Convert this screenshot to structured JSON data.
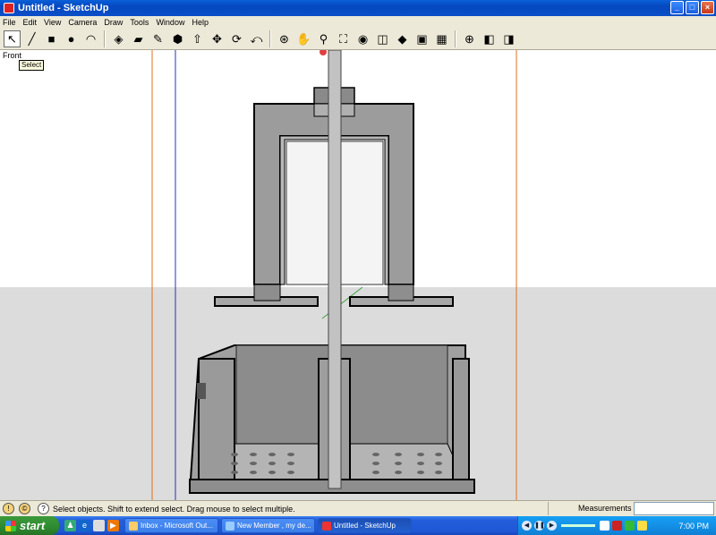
{
  "window": {
    "title": "Untitled - SketchUp",
    "buttons": {
      "minimize": "_",
      "maximize": "□",
      "close": "×"
    }
  },
  "menu": [
    "File",
    "Edit",
    "View",
    "Camera",
    "Draw",
    "Tools",
    "Window",
    "Help"
  ],
  "toolbar": {
    "tools": [
      {
        "name": "select",
        "glyph": "↖",
        "active": true
      },
      {
        "name": "line",
        "glyph": "╱"
      },
      {
        "name": "rectangle",
        "glyph": "■"
      },
      {
        "name": "circle",
        "glyph": "●"
      },
      {
        "name": "arc",
        "glyph": "◠"
      },
      {
        "name": "make-component",
        "glyph": "◈"
      },
      {
        "name": "eraser",
        "glyph": "▰"
      },
      {
        "name": "tape-measure",
        "glyph": "✎"
      },
      {
        "name": "paint-bucket",
        "glyph": "⬢"
      },
      {
        "name": "push-pull",
        "glyph": "⇧"
      },
      {
        "name": "move",
        "glyph": "✥"
      },
      {
        "name": "rotate",
        "glyph": "⟳"
      },
      {
        "name": "offset",
        "glyph": "⤺"
      },
      {
        "name": "orbit",
        "glyph": "⊛"
      },
      {
        "name": "pan",
        "glyph": "✋"
      },
      {
        "name": "zoom",
        "glyph": "⚲"
      },
      {
        "name": "zoom-extents",
        "glyph": "⛶"
      },
      {
        "name": "get-models",
        "glyph": "◉"
      },
      {
        "name": "share-model",
        "glyph": "◫"
      },
      {
        "name": "share-component",
        "glyph": "◆"
      },
      {
        "name": "get-photo-texture",
        "glyph": "▣"
      },
      {
        "name": "components",
        "glyph": "▦"
      },
      {
        "name": "position-camera",
        "glyph": "⊕"
      },
      {
        "name": "section-plane",
        "glyph": "◧"
      },
      {
        "name": "display-section",
        "glyph": "◨"
      }
    ]
  },
  "viewport": {
    "view_label": "Front",
    "tooltip": "Select"
  },
  "status": {
    "text": "Select objects. Shift to extend select. Drag mouse to select multiple.",
    "measurements_label": "Measurements",
    "measurements_value": ""
  },
  "taskbar": {
    "start_label": "start",
    "tasks": [
      {
        "label": "Inbox - Microsoft Out...",
        "active": false
      },
      {
        "label": "New Member , my de...",
        "active": false
      },
      {
        "label": "Untitled - SketchUp",
        "active": true
      }
    ],
    "clock": "7:00 PM"
  },
  "colors": {
    "title_blue": "#0548c0",
    "sky": "#ffffff",
    "ground": "#dcdcdc",
    "model_fill": "#9a9a9a",
    "axis_red": "#e0701c",
    "axis_blue": "#2030c0"
  }
}
